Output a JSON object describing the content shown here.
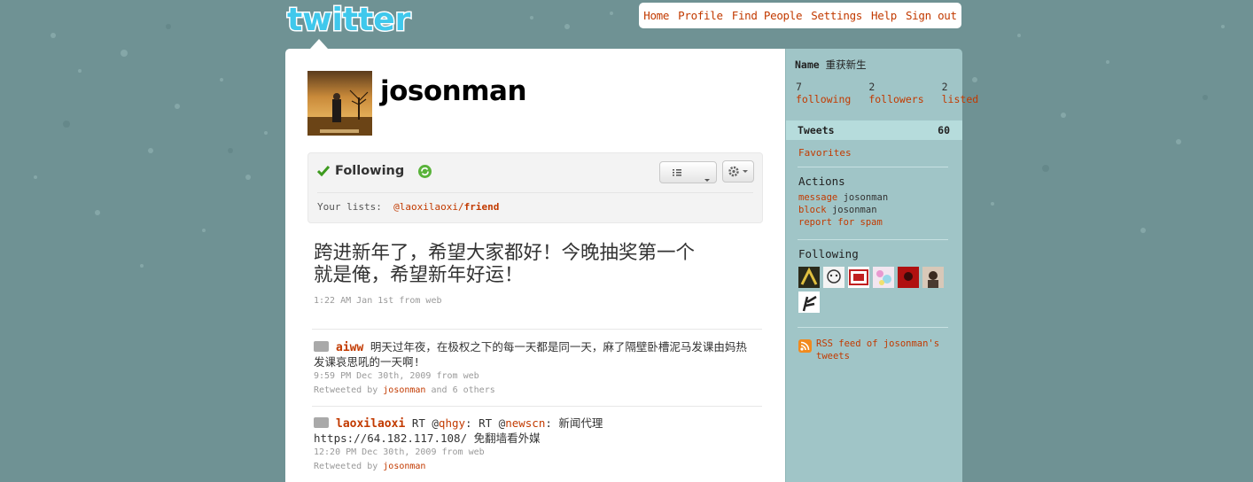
{
  "logo": {
    "text": "twitter"
  },
  "topnav": [
    {
      "label": "Home"
    },
    {
      "label": "Profile"
    },
    {
      "label": "Find People"
    },
    {
      "label": "Settings"
    },
    {
      "label": "Help"
    },
    {
      "label": "Sign out"
    }
  ],
  "profile": {
    "screen_name": "josonman",
    "following_status": "Following",
    "your_lists_label": "Your lists:",
    "list_owner": "@laoxilaoxi/",
    "list_name": "friend"
  },
  "latest_tweet": {
    "text": "跨进新年了，希望大家都好！今晚抽奖第一个就是俺，希望新年好运！",
    "meta": "1:22 AM Jan 1st from web"
  },
  "timeline": [
    {
      "author": "aiww",
      "text": "明天过年夜，在极权之下的每一天都是同一天，麻了隔壁卧槽泥马发课由妈热发课哀思吼的一天啊!",
      "meta": "9:59 PM Dec 30th, 2009 from web",
      "retweeted_prefix": "Retweeted by",
      "retweeted_by": "josonman",
      "retweeted_suffix": "and 6 others"
    },
    {
      "author": "laoxilaoxi",
      "text_a": "RT @",
      "mention1": "qhgy",
      "text_b": ": RT @",
      "mention2": "newscn",
      "text_c": ": 新闻代理 https://64.182.117.108/ 免翻墙看外媒",
      "meta": "12:20 PM Dec 30th, 2009 from web",
      "retweeted_prefix": "Retweeted by",
      "retweeted_by": "josonman"
    }
  ],
  "sidebar": {
    "name_label": "Name",
    "name_value": "重获新生",
    "stats": [
      {
        "num": "7",
        "label": "following"
      },
      {
        "num": "2",
        "label": "followers"
      },
      {
        "num": "2",
        "label": "listed"
      }
    ],
    "tweets_label": "Tweets",
    "tweets_count": "60",
    "favorites": "Favorites",
    "actions_title": "Actions",
    "actions": [
      {
        "link": "message",
        "target": "josonman"
      },
      {
        "link": "block",
        "target": "josonman"
      },
      {
        "link": "report for spam",
        "target": ""
      }
    ],
    "following_title": "Following",
    "rss": "RSS feed of josonman's tweets"
  },
  "colors": {
    "background": "#6f9294",
    "link": "#c23a00",
    "sidebar": "#a0c5c7",
    "sidebar_active": "#b6dcdc"
  }
}
